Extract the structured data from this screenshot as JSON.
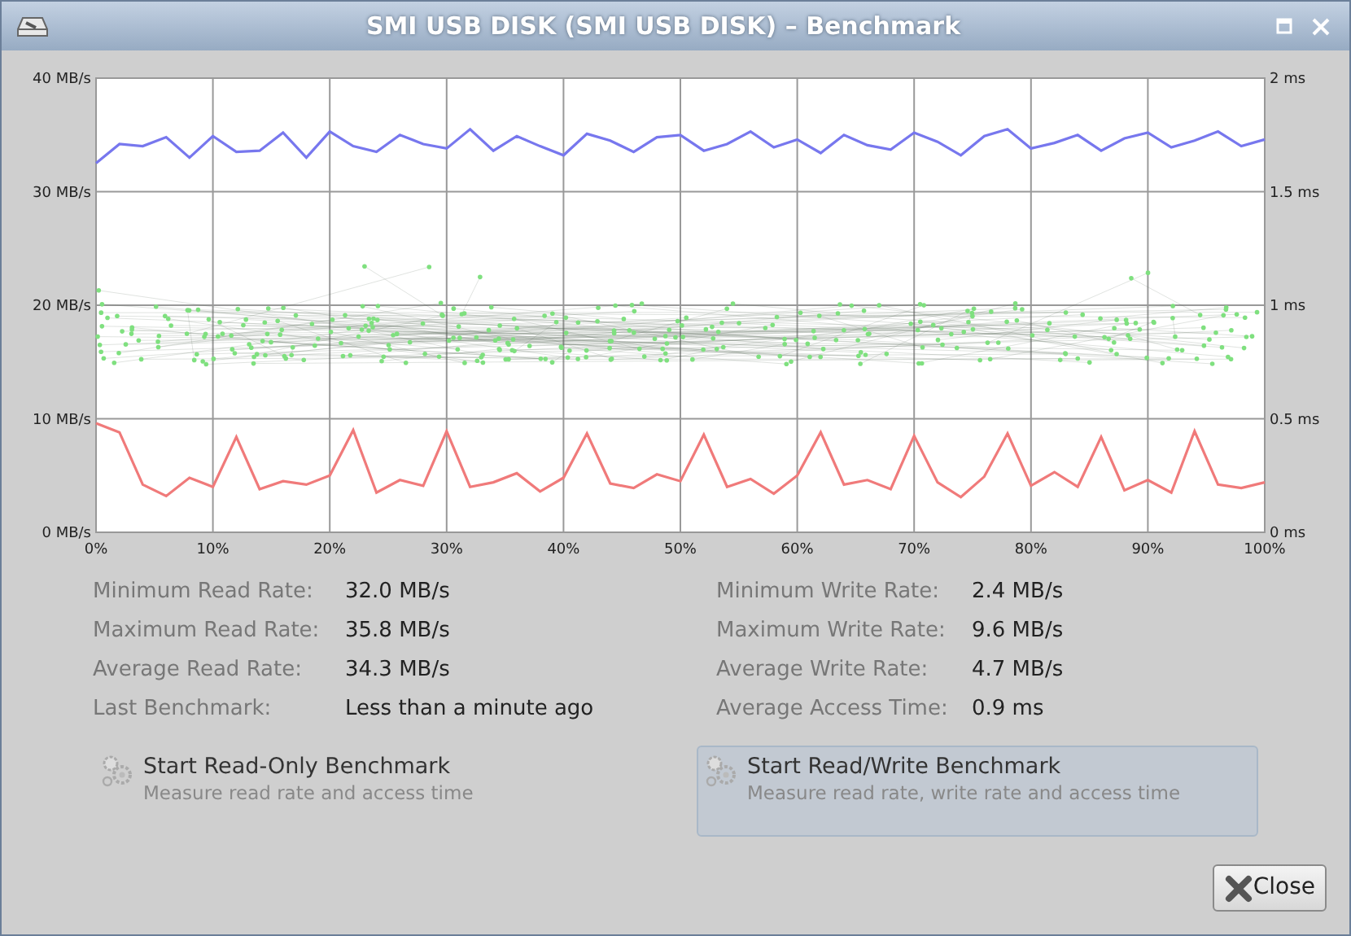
{
  "window": {
    "title": "SMI USB DISK (SMI USB DISK) – Benchmark"
  },
  "chart": {
    "chart_data": {
      "type": "line",
      "grid": true,
      "x": [
        0,
        2,
        4,
        6,
        8,
        10,
        12,
        14,
        16,
        18,
        20,
        22,
        24,
        26,
        28,
        30,
        32,
        34,
        36,
        38,
        40,
        42,
        44,
        46,
        48,
        50,
        52,
        54,
        56,
        58,
        60,
        62,
        64,
        66,
        68,
        70,
        72,
        74,
        76,
        78,
        80,
        82,
        84,
        86,
        88,
        90,
        92,
        94,
        96,
        98,
        100
      ],
      "xlim": [
        0,
        100
      ],
      "ylim": [
        0,
        40
      ],
      "y2lim": [
        0,
        2
      ],
      "xticks": [
        {
          "value": 0,
          "label": "0%"
        },
        {
          "value": 10,
          "label": "10%"
        },
        {
          "value": 20,
          "label": "20%"
        },
        {
          "value": 30,
          "label": "30%"
        },
        {
          "value": 40,
          "label": "40%"
        },
        {
          "value": 50,
          "label": "50%"
        },
        {
          "value": 60,
          "label": "60%"
        },
        {
          "value": 70,
          "label": "70%"
        },
        {
          "value": 80,
          "label": "80%"
        },
        {
          "value": 90,
          "label": "90%"
        },
        {
          "value": 100,
          "label": "100%"
        }
      ],
      "yticks": [
        {
          "value": 0,
          "label": "0 MB/s"
        },
        {
          "value": 10,
          "label": "10 MB/s"
        },
        {
          "value": 20,
          "label": "20 MB/s"
        },
        {
          "value": 30,
          "label": "30 MB/s"
        },
        {
          "value": 40,
          "label": "40 MB/s"
        }
      ],
      "y2ticks": [
        {
          "value": 0,
          "label": "0 ms"
        },
        {
          "value": 0.5,
          "label": "0.5 ms"
        },
        {
          "value": 1,
          "label": "1 ms"
        },
        {
          "value": 1.5,
          "label": "1.5 ms"
        },
        {
          "value": 2,
          "label": "2 ms"
        }
      ],
      "series": [
        {
          "color": "#7777ee",
          "values": [
            32.5,
            34.2,
            34.0,
            34.8,
            33.0,
            34.9,
            33.5,
            33.6,
            35.2,
            33.0,
            35.3,
            34.0,
            33.5,
            35.0,
            34.2,
            33.8,
            35.5,
            33.6,
            34.9,
            34.0,
            33.2,
            35.1,
            34.5,
            33.5,
            34.8,
            35.0,
            33.6,
            34.2,
            35.3,
            33.9,
            34.6,
            33.4,
            35.0,
            34.1,
            33.7,
            35.2,
            34.4,
            33.2,
            34.9,
            35.5,
            33.8,
            34.3,
            35.0,
            33.6,
            34.7,
            35.2,
            33.9,
            34.5,
            35.3,
            34.0,
            34.6
          ]
        },
        {
          "color": "#f07a7a",
          "values": [
            9.6,
            8.8,
            4.2,
            3.2,
            4.8,
            4.0,
            8.4,
            3.8,
            4.5,
            4.2,
            5.0,
            9.0,
            3.5,
            4.6,
            4.1,
            8.9,
            4.0,
            4.4,
            5.2,
            3.6,
            4.8,
            8.7,
            4.3,
            3.9,
            5.1,
            4.5,
            8.6,
            4.0,
            4.7,
            3.4,
            5.0,
            8.8,
            4.2,
            4.6,
            3.8,
            8.5,
            4.4,
            3.1,
            4.9,
            8.7,
            4.1,
            5.3,
            4.0,
            8.4,
            3.7,
            4.6,
            3.5,
            8.9,
            4.2,
            3.9,
            4.4
          ]
        }
      ]
    }
  },
  "stats_left": [
    {
      "label": "Minimum Read Rate:",
      "value": "32.0 MB/s"
    },
    {
      "label": "Maximum Read Rate:",
      "value": "35.8 MB/s"
    },
    {
      "label": "Average Read Rate:",
      "value": "34.3 MB/s"
    },
    {
      "label": "Last Benchmark:",
      "value": "Less than a minute ago"
    }
  ],
  "stats_right": [
    {
      "label": "Minimum Write Rate:",
      "value": "2.4 MB/s"
    },
    {
      "label": "Maximum Write Rate:",
      "value": "9.6 MB/s"
    },
    {
      "label": "Average Write Rate:",
      "value": "4.7 MB/s"
    },
    {
      "label": "Average Access Time:",
      "value": "0.9 ms"
    }
  ],
  "actions": [
    {
      "title": "Start Read-Only Benchmark",
      "description": "Measure read rate and access time",
      "highlighted": false
    },
    {
      "title": "Start Read/Write Benchmark",
      "description": "Measure read rate, write rate and access time",
      "highlighted": true
    }
  ],
  "close_button": {
    "label": "Close"
  }
}
